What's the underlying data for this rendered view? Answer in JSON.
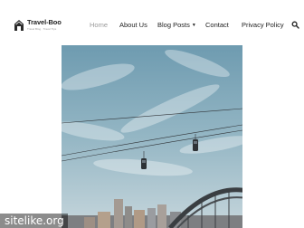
{
  "site": {
    "logo_name": "Travel-Boo",
    "logo_tagline": "Travel Blog · Travel Tips"
  },
  "nav": {
    "items": [
      {
        "label": "Home",
        "active": true
      },
      {
        "label": "About Us",
        "active": false
      },
      {
        "label": "Blog Posts",
        "active": false,
        "has_dropdown": true
      },
      {
        "label": "Contact",
        "active": false
      },
      {
        "label": "Privacy Policy",
        "active": false
      }
    ],
    "dropdown_icon": "chevron-down-icon",
    "search_icon": "search-icon"
  },
  "hero": {
    "subject": "cable cars over a harbour city"
  },
  "watermark": {
    "text": "sitelike.org"
  },
  "colors": {
    "text": "#222222",
    "active_nav": "#9a9a9a",
    "background": "#ffffff",
    "sky": "#7fa6b8"
  }
}
